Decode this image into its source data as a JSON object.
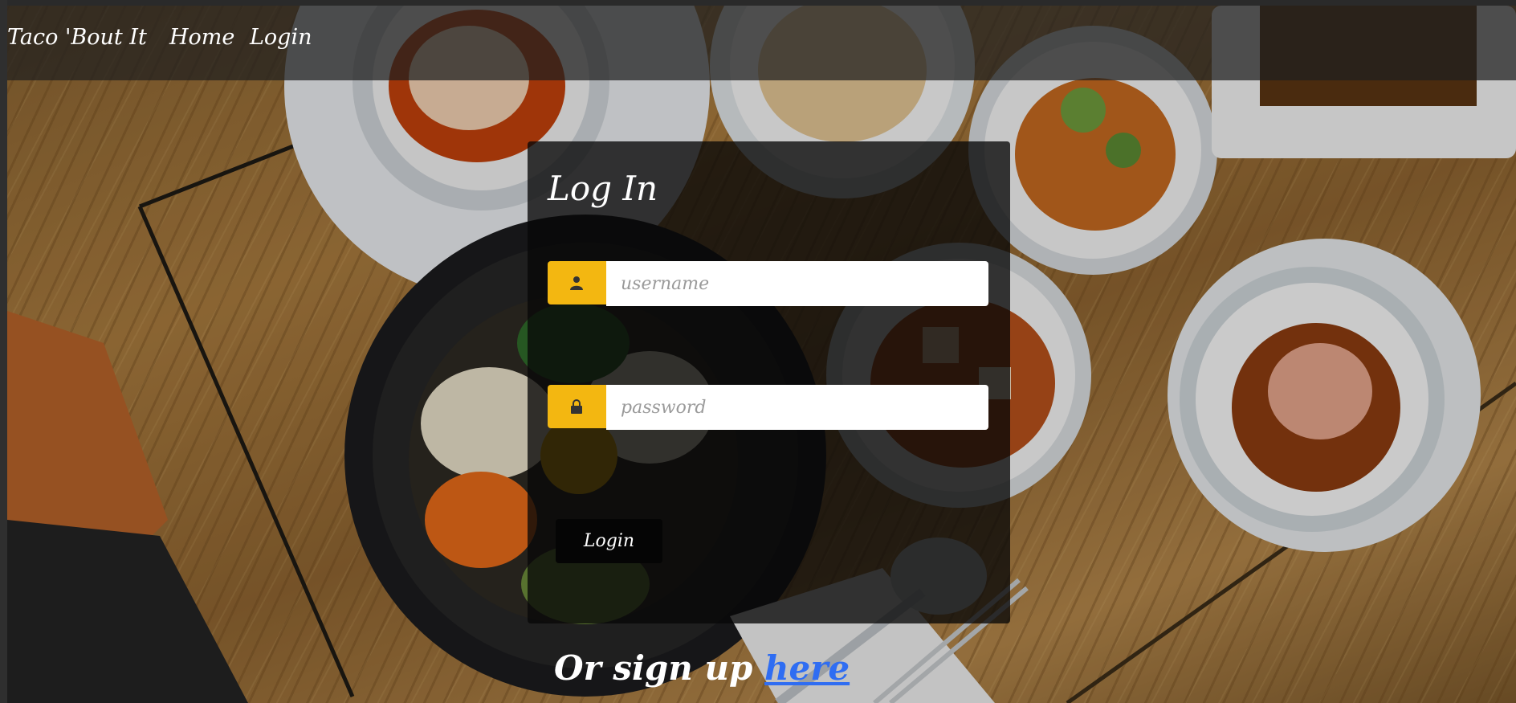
{
  "page": {
    "title": "Log In"
  },
  "navbar": {
    "brand": "Taco 'Bout It",
    "links": [
      {
        "label": "Home"
      },
      {
        "label": "Login"
      }
    ]
  },
  "login_form": {
    "title": "Log In",
    "username": {
      "placeholder": "username",
      "value": "",
      "icon": "user-icon"
    },
    "password": {
      "placeholder": "password",
      "value": "",
      "icon": "lock-icon"
    },
    "submit_label": "Login"
  },
  "signup": {
    "prefix": "Or sign up",
    "link_label": "here"
  },
  "colors": {
    "accent": "#f3b711",
    "link": "#2f6df2",
    "nav_bg": "rgba(30,30,30,0.72)",
    "card_bg": "rgba(8,8,8,0.78)"
  },
  "background": {
    "description_icon": "food-table-photo"
  }
}
